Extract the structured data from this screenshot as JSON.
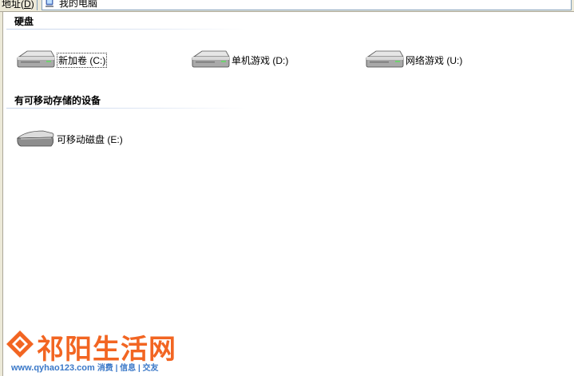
{
  "address_bar": {
    "label": "地址",
    "accel": "D",
    "path": "我的电脑"
  },
  "groups": [
    {
      "title": "硬盘",
      "items": [
        {
          "name": "新加卷",
          "letter": "(C:)",
          "icon": "hard-drive-icon",
          "selected": true
        },
        {
          "name": "单机游戏",
          "letter": "(D:)",
          "icon": "hard-drive-icon",
          "selected": false
        },
        {
          "name": "网络游戏",
          "letter": "(U:)",
          "icon": "hard-drive-icon",
          "selected": false
        }
      ]
    },
    {
      "title": "有可移动存储的设备",
      "items": [
        {
          "name": "可移动磁盘",
          "letter": "(E:)",
          "icon": "removable-disk-icon",
          "selected": false
        }
      ]
    }
  ],
  "watermark": {
    "title": "祁阳生活网",
    "url": "www.qyhao123.com",
    "tags": "消费 | 信息 | 交友",
    "color": "#f26522"
  }
}
